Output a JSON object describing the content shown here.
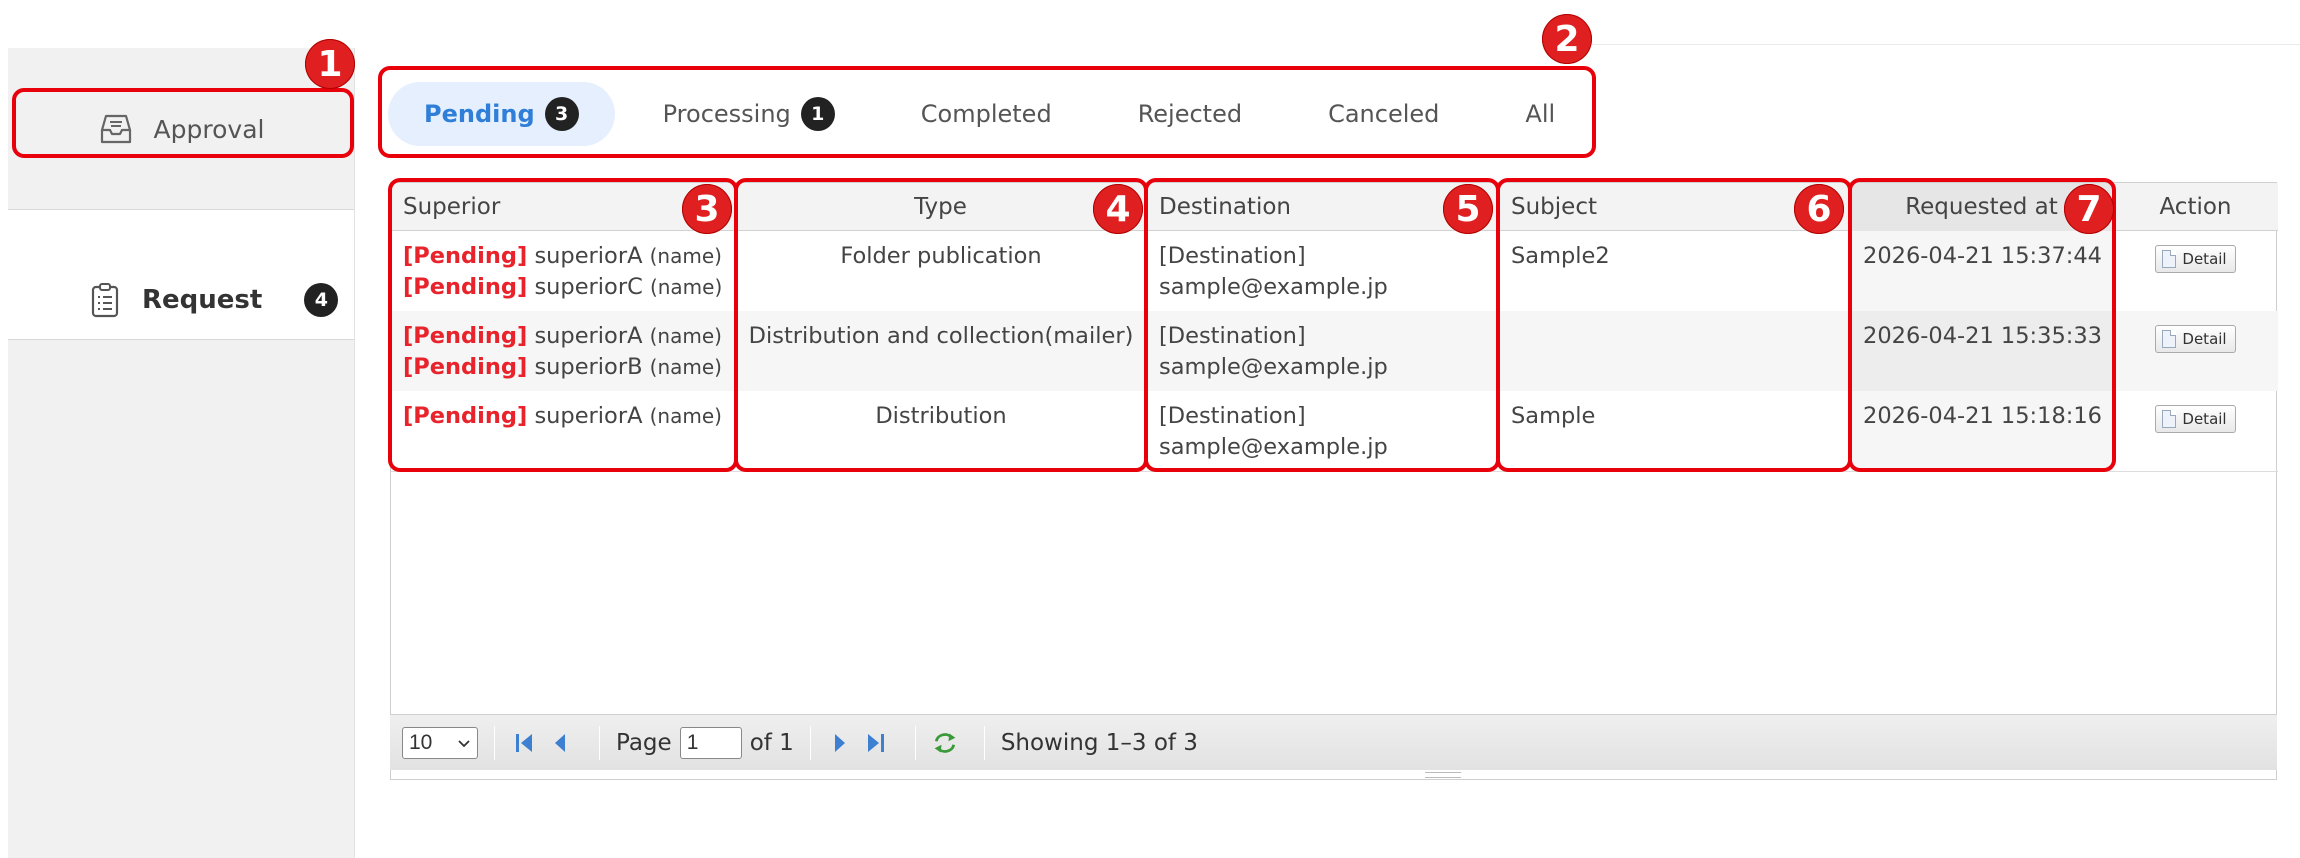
{
  "sidebar": {
    "approval_label": "Approval",
    "request_label": "Request",
    "request_count": "4"
  },
  "tabs": [
    {
      "label": "Pending",
      "count": "3",
      "active": true
    },
    {
      "label": "Processing",
      "count": "1"
    },
    {
      "label": "Completed"
    },
    {
      "label": "Rejected"
    },
    {
      "label": "Canceled"
    },
    {
      "label": "All"
    }
  ],
  "table": {
    "headers": {
      "superior": "Superior",
      "type": "Type",
      "destination": "Destination",
      "subject": "Subject",
      "requested_at": "Requested at",
      "action": "Action"
    },
    "rows": [
      {
        "superiors": [
          {
            "status": "[Pending]",
            "user": "superiorA",
            "name": "(name)"
          },
          {
            "status": "[Pending]",
            "user": "superiorC",
            "name": "(name)"
          }
        ],
        "type": "Folder publication",
        "destination_label": "[Destination]",
        "destination_email": "sample@example.jp",
        "subject": "Sample2",
        "requested_at": "2026-04-21 15:37:44",
        "action": "Detail"
      },
      {
        "superiors": [
          {
            "status": "[Pending]",
            "user": "superiorA",
            "name": "(name)"
          },
          {
            "status": "[Pending]",
            "user": "superiorB",
            "name": "(name)"
          }
        ],
        "type": "Distribution and collection(mailer)",
        "destination_label": "[Destination]",
        "destination_email": "sample@example.jp",
        "subject": "",
        "requested_at": "2026-04-21 15:35:33",
        "action": "Detail"
      },
      {
        "superiors": [
          {
            "status": "[Pending]",
            "user": "superiorA",
            "name": "(name)"
          }
        ],
        "type": "Distribution",
        "destination_label": "[Destination]",
        "destination_email": "sample@example.jp",
        "subject": "Sample",
        "requested_at": "2026-04-21 15:18:16",
        "action": "Detail"
      }
    ]
  },
  "pager": {
    "page_size": "10",
    "page_label": "Page",
    "page_value": "1",
    "of_label": "of 1",
    "showing": "Showing 1–3 of 3"
  },
  "annotations": {
    "m1": "1",
    "m2": "2",
    "m3": "3",
    "m4": "4",
    "m5": "5",
    "m6": "6",
    "m7": "7"
  },
  "colors": {
    "accent": "#2f7fd8",
    "pending": "#e8232b",
    "annotation": "#e8000b"
  }
}
